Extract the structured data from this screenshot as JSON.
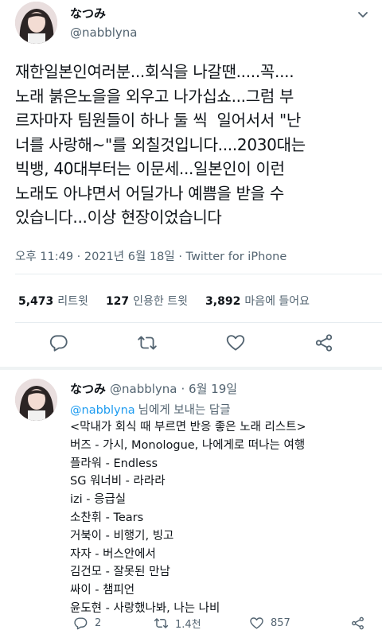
{
  "main_tweet": {
    "display_name": "なつみ",
    "handle": "@nabblyna",
    "text": "재한일본인여러분...회식을 나갈땐.....꼭....\n노래 붉은노을을 외우고 나가십쇼...그럼 부\n르자마자 팀원들이 하나 둘 씩  일어서서 \"난\n너를 사랑해~\"를 외칠것입니다....2030대는\n빅뱅, 40대부터는 이문세...일본인이 이런\n노래도 아냐면서 어딜가나 예쁨을 받을 수\n있습니다...이상 현장이었습니다",
    "meta": "오후 11:49 · 2021년 6월 18일 · Twitter for iPhone",
    "stats": [
      {
        "count": "5,473",
        "label": "리트윗"
      },
      {
        "count": "127",
        "label": "인용한 트윗"
      },
      {
        "count": "3,892",
        "label": "마음에 들어요"
      }
    ]
  },
  "reply_tweet": {
    "display_name": "なつみ",
    "handle": "@nabblyna",
    "date": "· 6월 19일",
    "reply_to_mention": "@nabblyna",
    "reply_to_suffix": "님에게 보내는 답글",
    "lines": [
      "<막내가 회식 때 부르면 반응 좋은 노래 리스트>",
      "버즈 - 가시, Monologue, 나에게로 떠나는 여행",
      "플라워 - Endless",
      "SG 워너비 - 라라라",
      "izi - 응급실",
      "소찬휘 - Tears",
      "거북이 - 비행기, 빙고",
      "자자 - 버스안에서",
      "김건모 - 잘못된 만남",
      "싸이 - 챔피언",
      "윤도현 - 사랑했나봐, 나는 나비"
    ],
    "reply_count": "2",
    "retweet_count": "1.4천",
    "like_count": "857"
  },
  "icons": {
    "reply": "reply-icon",
    "retweet": "retweet-icon",
    "like": "heart-icon",
    "share": "share-icon",
    "more": "chevron-down-icon"
  },
  "colors": {
    "text": "#0f1419",
    "secondary": "#536471",
    "link": "#1d9bf0",
    "divider": "#e6ecf0"
  }
}
